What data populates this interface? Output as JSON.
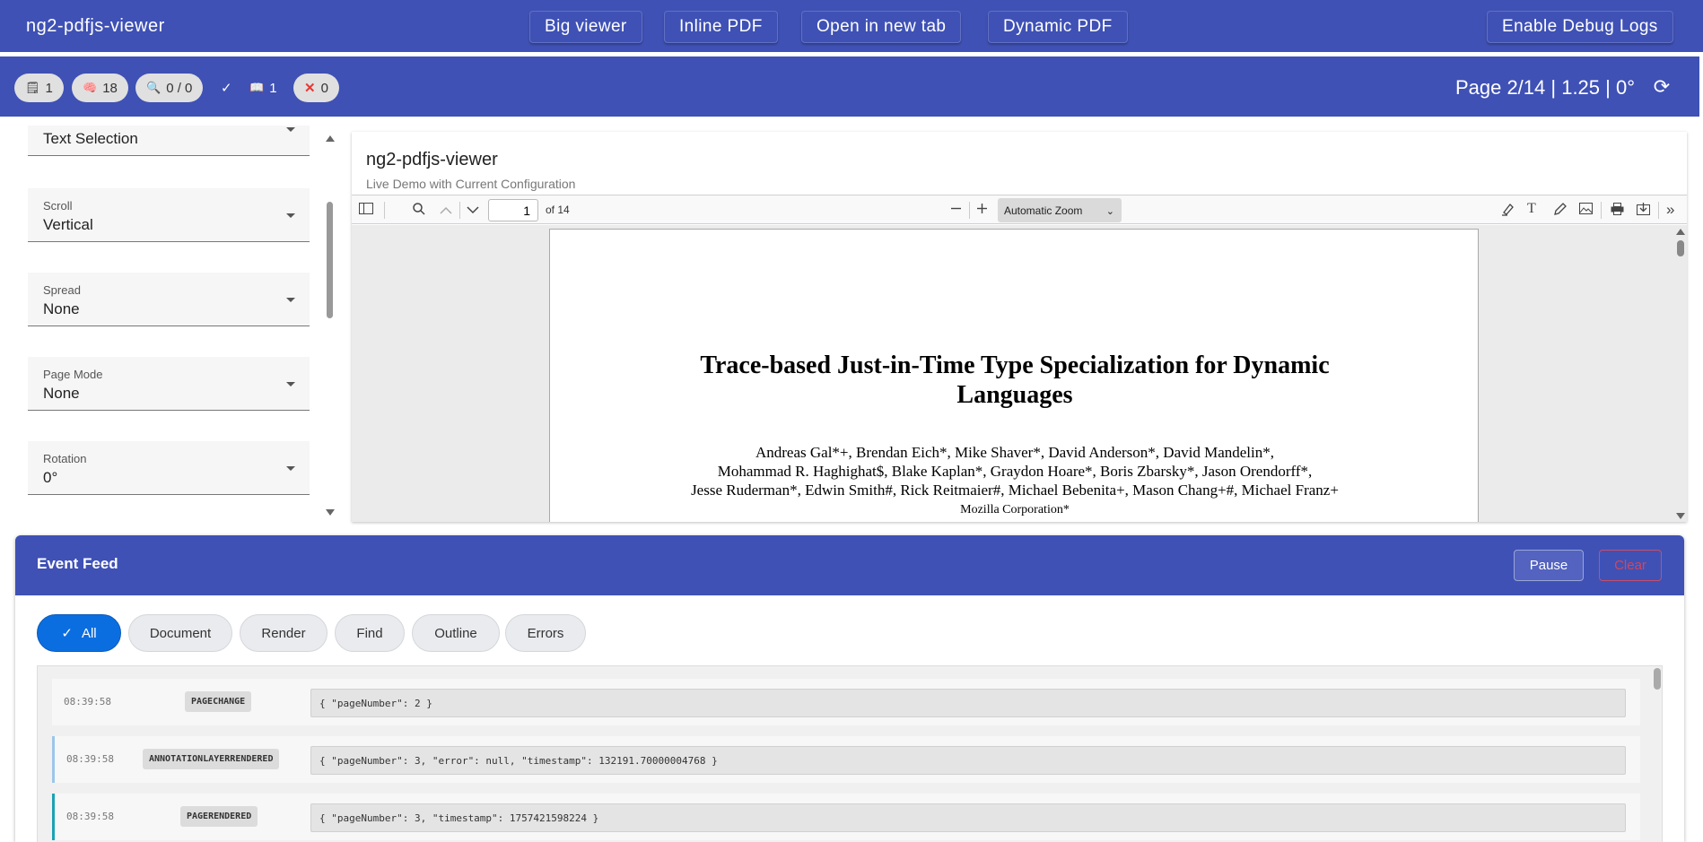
{
  "app": {
    "title": "ng2-pdfjs-viewer"
  },
  "nav": {
    "big_viewer": "Big viewer",
    "inline_pdf": "Inline PDF",
    "open_new_tab": "Open in new tab",
    "dynamic_pdf": "Dynamic PDF",
    "debug_logs": "Enable Debug Logs"
  },
  "status": {
    "chips": [
      {
        "icon": "page-icon",
        "value": "1"
      },
      {
        "icon": "brain-icon",
        "value": "18"
      },
      {
        "icon": "magnifier-icon",
        "value": "0 / 0"
      },
      {
        "icon": "check-icon",
        "value": ""
      },
      {
        "icon": "book-icon",
        "value": "1"
      },
      {
        "icon": "cross-icon",
        "value": "0"
      }
    ],
    "page_info": "Page 2/14 | 1.25 | 0°"
  },
  "settings": {
    "cursor": {
      "label": "",
      "value": "Text Selection"
    },
    "scroll": {
      "label": "Scroll",
      "value": "Vertical"
    },
    "spread": {
      "label": "Spread",
      "value": "None"
    },
    "page_mode": {
      "label": "Page Mode",
      "value": "None"
    },
    "rotation": {
      "label": "Rotation",
      "value": "0°"
    }
  },
  "viewer": {
    "title": "ng2-pdfjs-viewer",
    "subtitle": "Live Demo with Current Configuration",
    "toolbar": {
      "page_number": "1",
      "of_pages": "of 14",
      "zoom": "Automatic Zoom"
    },
    "paper": {
      "title_line1": "Trace-based Just-in-Time Type Specialization for Dynamic",
      "title_line2": "Languages",
      "authors_line1": "Andreas Gal*+, Brendan Eich*, Mike Shaver*, David Anderson*, David Mandelin*,",
      "authors_line2": "Mohammad R. Haghighat$, Blake Kaplan*, Graydon Hoare*, Boris Zbarsky*, Jason Orendorff*,",
      "authors_line3": "Jesse Ruderman*, Edwin Smith#, Rick Reitmaier#, Michael Bebenita+, Mason Chang+#, Michael Franz+",
      "affiliation": "Mozilla Corporation*"
    }
  },
  "event_feed": {
    "title": "Event Feed",
    "pause_label": "Pause",
    "clear_label": "Clear",
    "filters": [
      "All",
      "Document",
      "Render",
      "Find",
      "Outline",
      "Errors"
    ],
    "events": [
      {
        "time": "08:39:58",
        "type": "PAGECHANGE",
        "payload": "{ \"pageNumber\": 2 }"
      },
      {
        "time": "08:39:58",
        "type": "ANNOTATIONLAYERRENDERED",
        "payload": "{ \"pageNumber\": 3, \"error\": null, \"timestamp\": 132191.70000004768 }"
      },
      {
        "time": "08:39:58",
        "type": "PAGERENDERED",
        "payload": "{ \"pageNumber\": 3, \"timestamp\": 1757421598224 }"
      }
    ]
  }
}
